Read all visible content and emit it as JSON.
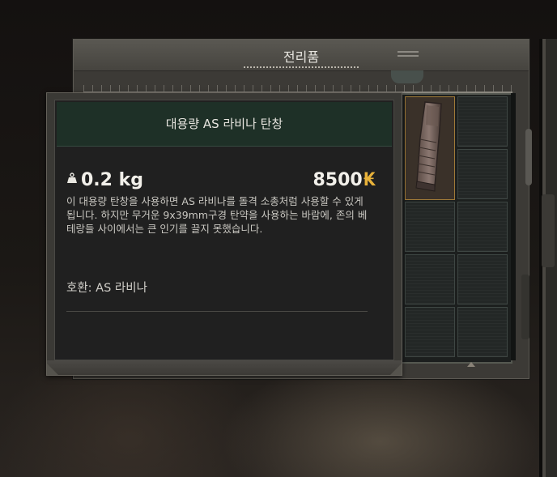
{
  "loot_window": {
    "title": "전리품"
  },
  "tooltip": {
    "item_name": "대용량 AS 라비나 탄창",
    "weight": "0.2 kg",
    "price": "8500",
    "currency_icon": "₭",
    "description": "이 대용량 탄창을 사용하면 AS 라비나를 돌격 소총처럼 사용할 수 있게 됩니다. 하지만 무거운 9x39mm구경 탄약을 사용하는 바람에, 존의 베테랑들 사이에서는 큰 인기를 끌지 못했습니다.",
    "compatibility": "호환: AS 라비나"
  },
  "icons": {
    "weight": "weight-icon",
    "currency": "coupon-currency-icon",
    "item": "magazine-icon"
  },
  "colors": {
    "header_green": "#1e3027",
    "currency_gold": "#e8b23a",
    "slot_border": "#a07a38"
  }
}
